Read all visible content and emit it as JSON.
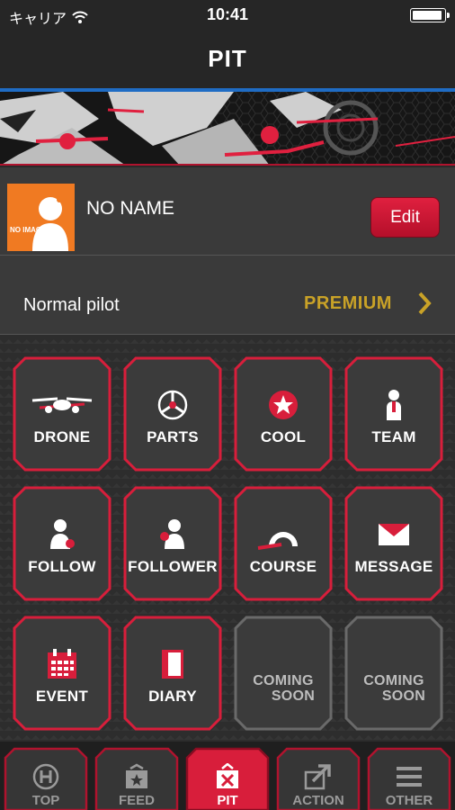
{
  "status_bar": {
    "carrier": "キャリア",
    "time": "10:41"
  },
  "nav": {
    "title": "PIT"
  },
  "profile": {
    "avatar_text": "NO IMAGE",
    "name": "NO NAME",
    "edit_label": "Edit"
  },
  "pilot": {
    "level": "Normal pilot",
    "plan": "PREMIUM"
  },
  "menu": [
    {
      "label": "DRONE",
      "icon": "drone-icon"
    },
    {
      "label": "PARTS",
      "icon": "propeller-icon"
    },
    {
      "label": "COOL",
      "icon": "star-badge-icon"
    },
    {
      "label": "TEAM",
      "icon": "person-icon"
    },
    {
      "label": "FOLLOW",
      "icon": "follow-icon"
    },
    {
      "label": "FOLLOWER",
      "icon": "follower-icon"
    },
    {
      "label": "COURSE",
      "icon": "arch-gate-icon"
    },
    {
      "label": "MESSAGE",
      "icon": "envelope-icon"
    },
    {
      "label": "EVENT",
      "icon": "calendar-icon"
    },
    {
      "label": "DIARY",
      "icon": "notebook-icon"
    },
    {
      "label_line1": "COMING",
      "label_line2": "SOON"
    },
    {
      "label_line1": "COMING",
      "label_line2": "SOON"
    }
  ],
  "tabs": [
    {
      "label": "TOP",
      "icon": "helipad-icon"
    },
    {
      "label": "FEED",
      "icon": "feed-icon"
    },
    {
      "label": "PIT",
      "icon": "pit-icon"
    },
    {
      "label": "ACTION",
      "icon": "share-arrow-icon"
    },
    {
      "label": "OTHER",
      "icon": "menu-icon"
    }
  ],
  "colors": {
    "accent": "#d81e3b",
    "premium": "#c9a227",
    "nav_line": "#1f6cc4",
    "avatar_bg": "#f07a22"
  }
}
